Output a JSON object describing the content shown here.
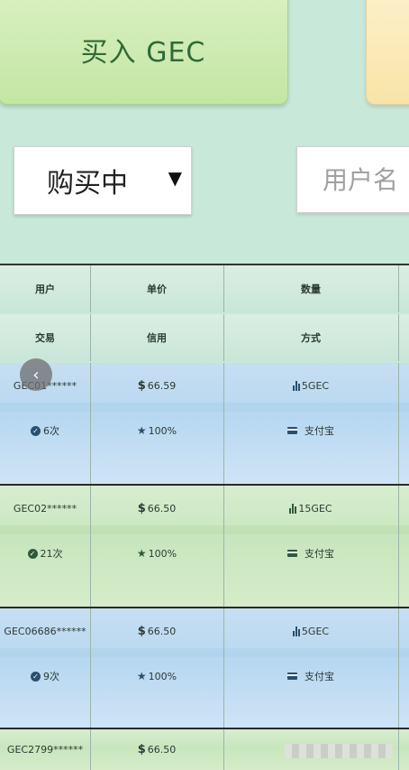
{
  "actions": {
    "buy_label": "买入 GEC"
  },
  "filter": {
    "status_value": "购买中",
    "arrow": "▼",
    "user_placeholder": "用户名"
  },
  "table": {
    "headers_row1": [
      "用户",
      "单价",
      "数量"
    ],
    "headers_row2": [
      "交易",
      "信用",
      "方式"
    ],
    "rows": [
      {
        "user": "GEC01******",
        "price": "66.59",
        "quantity": "5GEC",
        "trades": "6次",
        "credit": "100%",
        "method": "支付宝",
        "tint": "blue"
      },
      {
        "user": "GEC02******",
        "price": "66.50",
        "quantity": "15GEC",
        "trades": "21次",
        "credit": "100%",
        "method": "支付宝",
        "tint": "green"
      },
      {
        "user": "GEC06686******",
        "price": "66.50",
        "quantity": "5GEC",
        "trades": "9次",
        "credit": "100%",
        "method": "支付宝",
        "tint": "blue"
      },
      {
        "user": "GEC2799******",
        "price": "66.50",
        "tint": "green"
      }
    ]
  },
  "icons": {
    "back": "chevron-left-icon",
    "check": "check-circle-icon",
    "star": "star-icon",
    "bars": "bar-chart-icon",
    "card": "card-icon"
  },
  "colors": {
    "buy": "#c4e6a4",
    "sell": "#f8e4a8",
    "bg": "#c8e8da",
    "row_blue": "#b7d8f1",
    "row_green": "#c8e6be"
  }
}
